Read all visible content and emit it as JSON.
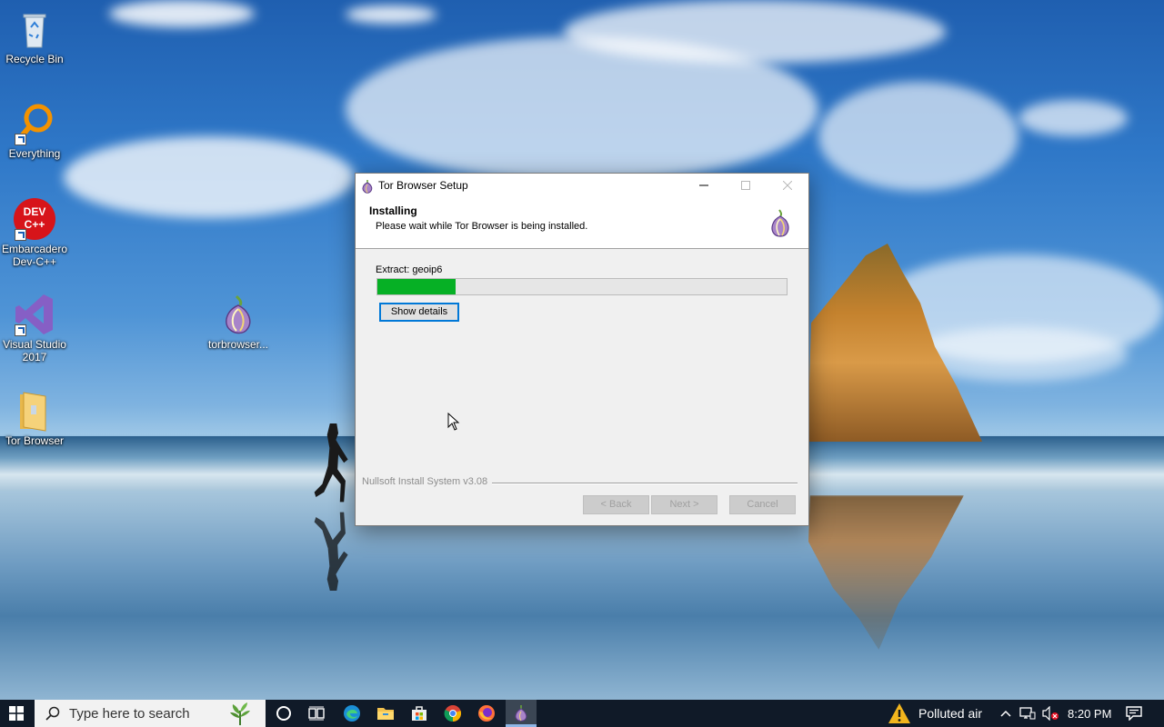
{
  "desktop": {
    "icons": [
      {
        "label": "Recycle Bin"
      },
      {
        "label": "Everything"
      },
      {
        "label": "Embarcadero Dev-C++"
      },
      {
        "label": "Visual Studio 2017"
      },
      {
        "label": "Tor Browser"
      },
      {
        "label": "torbrowser..."
      }
    ],
    "devcpp_glyph_text": "DEV C++"
  },
  "installer": {
    "window_title": "Tor Browser Setup",
    "header_title": "Installing",
    "header_subtitle": "Please wait while Tor Browser is being installed.",
    "status_text": "Extract: geoip6",
    "progress": 0.19,
    "show_details_label": "Show details",
    "branding": "Nullsoft Install System v3.08",
    "back_label": "< Back",
    "next_label": "Next >",
    "cancel_label": "Cancel",
    "accent_color": "#06b025"
  },
  "taskbar": {
    "search_placeholder": "Type here to search",
    "weather_text": "Polluted air",
    "clock": "8:20 PM"
  }
}
